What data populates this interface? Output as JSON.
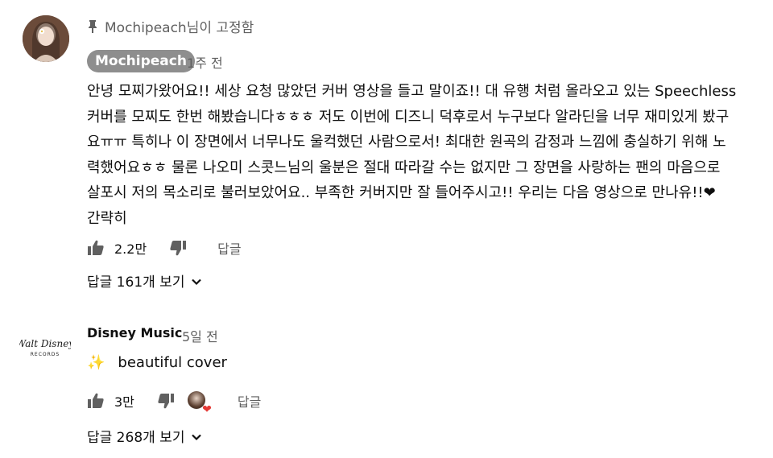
{
  "comments": [
    {
      "pinned_text": "Mochipeach님이 고정함",
      "author": "Mochipeach",
      "time": "1주 전",
      "text": "안녕 모찌가왔어요!! 세상 요청 많았던 커버 영상을 들고 말이죠!! 대 유행 처럼 올라오고 있는 Speechless\n커버를 모찌도 한번 해봤습니다ㅎㅎㅎ 저도 이번에 디즈니 덕후로서 누구보다 알라딘을 너무 재미있게 봤구\n요ㅠㅠ 특히나 이 장면에서 너무나도 울컥했던 사람으로서! 최대한 원곡의 감정과 느낌에 충실하기 위해 노\n력했어요ㅎㅎ 물론 나오미 스콧느님의 울분은 절대 따라갈 수는 없지만 그 장면을 사랑하는 팬의 마음으로\n살포시 저의 목소리로 불러보았어요.. 부족한 커버지만 잘 들어주시고!! 우리는 다음 영상으로 만나유!!❤\n간략히",
      "likes": "2.2만",
      "reply_label": "답글",
      "view_replies": "답글 161개 보기"
    },
    {
      "author": "Disney Music",
      "time": "5일 전",
      "sparkle": "✨",
      "text": "beautiful cover",
      "likes": "3만",
      "reply_label": "답글",
      "view_replies": "답글 268개 보기",
      "logo_text": "WALT DISNEY RECORDS"
    }
  ],
  "icons": {
    "pin": "pin-icon",
    "like": "thumbs-up-icon",
    "dislike": "thumbs-down-icon",
    "chevron": "chevron-down-icon",
    "heart": "heart-icon"
  },
  "colors": {
    "badge_bg": "#8e8e8e",
    "secondary_text": "#606060",
    "heart": "#e53935"
  }
}
